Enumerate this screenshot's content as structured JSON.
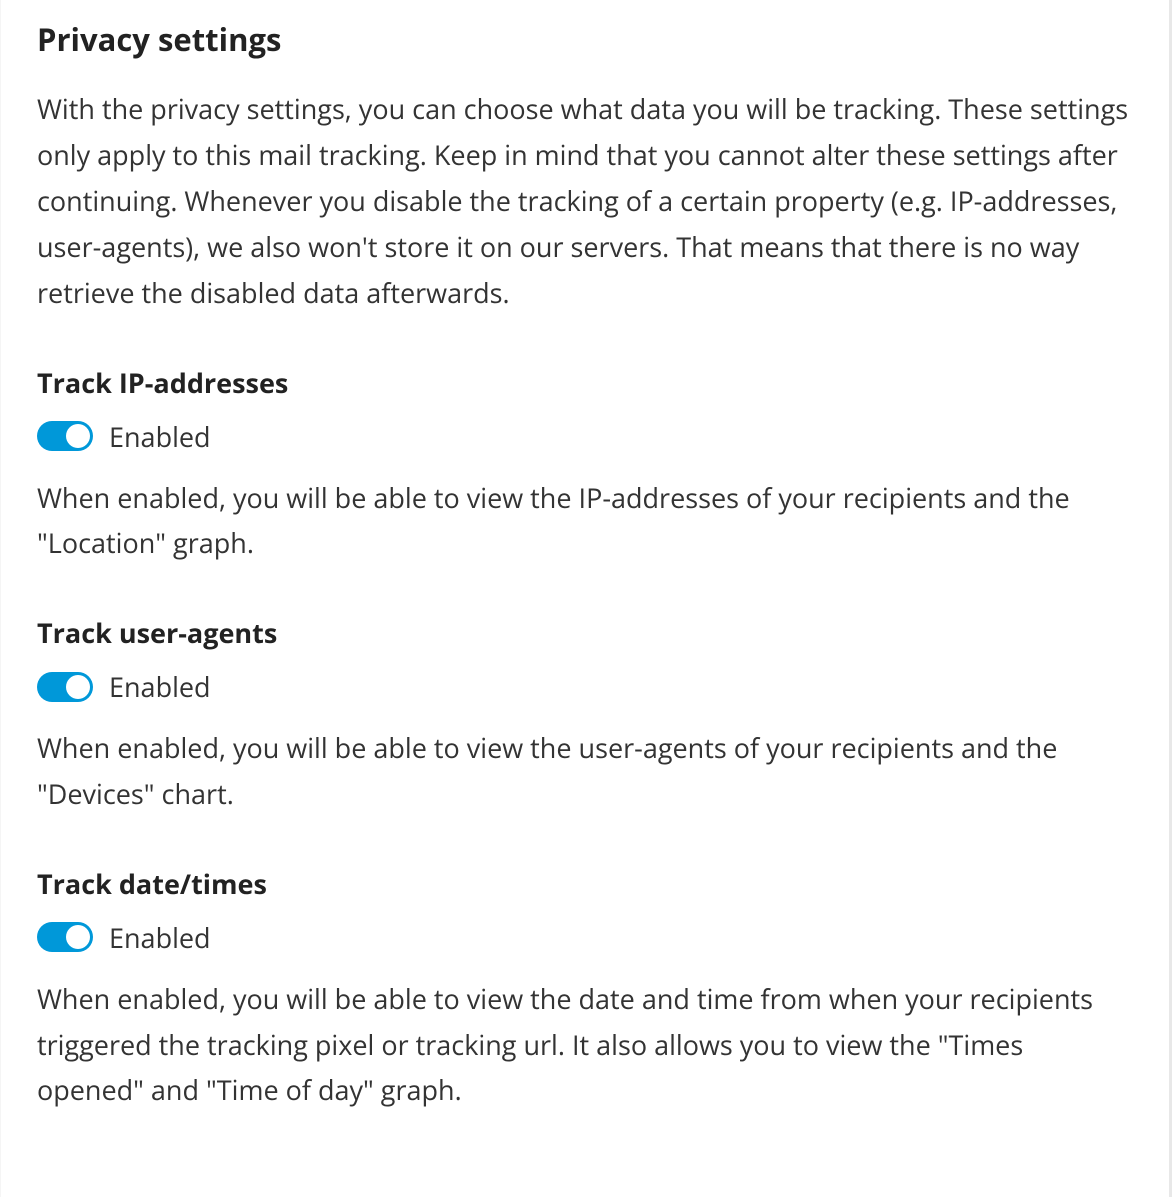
{
  "header": {
    "title": "Privacy settings",
    "description": "With the privacy settings, you can choose what data you will be tracking. These settings only apply to this mail tracking. Keep in mind that you cannot alter these settings after continuing. Whenever you disable the tracking of a certain property (e.g. IP-addresses, user-agents), we also won't store it on our servers. That means that there is no way retrieve the disabled data afterwards."
  },
  "settings": {
    "ip": {
      "title": "Track IP-addresses",
      "enabled": true,
      "status_label": "Enabled",
      "description": "When enabled, you will be able to view the IP-addresses of your recipients and the \"Location\" graph."
    },
    "user_agents": {
      "title": "Track user-agents",
      "enabled": true,
      "status_label": "Enabled",
      "description": "When enabled, you will be able to view the user-agents of your recipients and the \"Devices\" chart."
    },
    "datetimes": {
      "title": "Track date/times",
      "enabled": true,
      "status_label": "Enabled",
      "description": "When enabled, you will be able to view the date and time from when your recipients triggered the tracking pixel or tracking url. It also allows you to view the \"Times opened\" and \"Time of day\" graph."
    }
  },
  "colors": {
    "accent": "#0098d9"
  }
}
